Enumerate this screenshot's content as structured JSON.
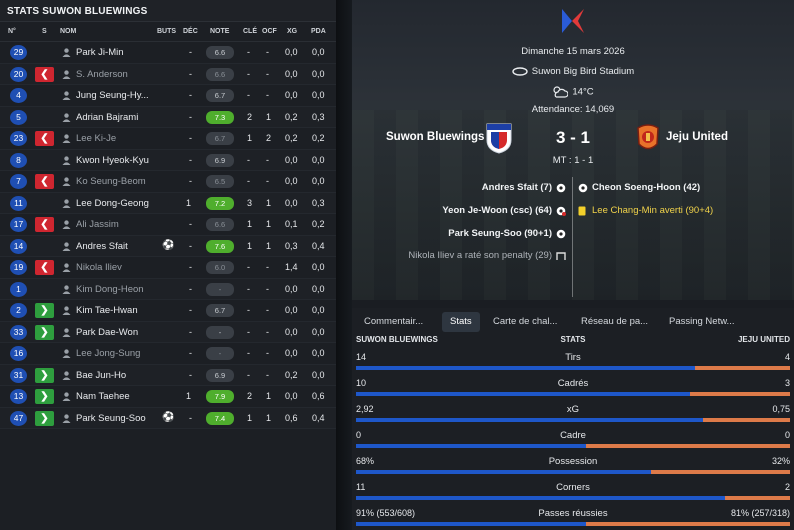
{
  "left": {
    "title": "STATS SUWON BLUEWINGS",
    "columns": {
      "no": "N°",
      "s": "S",
      "nom": "NOM",
      "buts": "BUTS",
      "dec": "DÉC",
      "note": "NOTE",
      "cle": "CLÉ",
      "ocf": "OCF",
      "xg": "XG",
      "pda": "PDA"
    },
    "players": [
      {
        "num": "29",
        "sub": "",
        "name": "Park Ji-Min",
        "goal": false,
        "buts": "",
        "dec": "-",
        "note": "6.6",
        "hi": false,
        "cle": "-",
        "ocf": "-",
        "xg": "0,0",
        "pda": "0,0",
        "dim": false
      },
      {
        "num": "20",
        "sub": "out",
        "name": "S. Anderson",
        "goal": false,
        "buts": "",
        "dec": "-",
        "note": "6.6",
        "hi": false,
        "cle": "-",
        "ocf": "-",
        "xg": "0,0",
        "pda": "0,0",
        "dim": true
      },
      {
        "num": "4",
        "sub": "",
        "name": "Jung Seung-Hy...",
        "goal": false,
        "buts": "",
        "dec": "-",
        "note": "6.7",
        "hi": false,
        "cle": "-",
        "ocf": "-",
        "xg": "0,0",
        "pda": "0,0",
        "dim": false
      },
      {
        "num": "5",
        "sub": "",
        "name": "Adrian Bajrami",
        "goal": false,
        "buts": "",
        "dec": "-",
        "note": "7.3",
        "hi": true,
        "cle": "2",
        "ocf": "1",
        "xg": "0,2",
        "pda": "0,3",
        "dim": false
      },
      {
        "num": "23",
        "sub": "out",
        "name": "Lee Ki-Je",
        "goal": false,
        "buts": "",
        "dec": "-",
        "note": "6.7",
        "hi": false,
        "cle": "1",
        "ocf": "2",
        "xg": "0,2",
        "pda": "0,2",
        "dim": true
      },
      {
        "num": "8",
        "sub": "",
        "name": "Kwon Hyeok-Kyu",
        "goal": false,
        "buts": "",
        "dec": "-",
        "note": "6.9",
        "hi": false,
        "cle": "-",
        "ocf": "-",
        "xg": "0,0",
        "pda": "0,0",
        "dim": false
      },
      {
        "num": "7",
        "sub": "out",
        "name": "Ko Seung-Beom",
        "goal": false,
        "buts": "",
        "dec": "-",
        "note": "6.5",
        "hi": false,
        "cle": "-",
        "ocf": "-",
        "xg": "0,0",
        "pda": "0,0",
        "dim": true
      },
      {
        "num": "11",
        "sub": "",
        "name": "Lee Dong-Geong",
        "goal": false,
        "buts": "1",
        "dec": "",
        "note": "7.2",
        "hi": true,
        "cle": "3",
        "ocf": "1",
        "xg": "0,0",
        "pda": "0,3",
        "dim": false
      },
      {
        "num": "17",
        "sub": "out",
        "name": "Ali Jassim",
        "goal": false,
        "buts": "",
        "dec": "-",
        "note": "6.6",
        "hi": false,
        "cle": "1",
        "ocf": "1",
        "xg": "0,1",
        "pda": "0,2",
        "dim": true
      },
      {
        "num": "14",
        "sub": "",
        "name": "Andres Sfait",
        "goal": true,
        "buts": "",
        "dec": "-",
        "note": "7.6",
        "hi": true,
        "cle": "1",
        "ocf": "1",
        "xg": "0,3",
        "pda": "0,4",
        "dim": false
      },
      {
        "num": "19",
        "sub": "out",
        "name": "Nikola Iliev",
        "goal": false,
        "buts": "",
        "dec": "-",
        "note": "6.0",
        "hi": false,
        "cle": "-",
        "ocf": "-",
        "xg": "1,4",
        "pda": "0,0",
        "dim": true
      },
      {
        "num": "1",
        "sub": "",
        "name": "Kim Dong-Heon",
        "goal": false,
        "buts": "",
        "dec": "-",
        "note": "-",
        "hi": false,
        "cle": "-",
        "ocf": "-",
        "xg": "0,0",
        "pda": "0,0",
        "dim": true
      },
      {
        "num": "2",
        "sub": "in",
        "name": "Kim Tae-Hwan",
        "goal": false,
        "buts": "",
        "dec": "-",
        "note": "6.7",
        "hi": false,
        "cle": "-",
        "ocf": "-",
        "xg": "0,0",
        "pda": "0,0",
        "dim": false
      },
      {
        "num": "33",
        "sub": "in",
        "name": "Park Dae-Won",
        "goal": false,
        "buts": "",
        "dec": "-",
        "note": "-",
        "hi": false,
        "cle": "-",
        "ocf": "-",
        "xg": "0,0",
        "pda": "0,0",
        "dim": false
      },
      {
        "num": "16",
        "sub": "",
        "name": "Lee Jong-Sung",
        "goal": false,
        "buts": "",
        "dec": "-",
        "note": "-",
        "hi": false,
        "cle": "-",
        "ocf": "-",
        "xg": "0,0",
        "pda": "0,0",
        "dim": true
      },
      {
        "num": "31",
        "sub": "in",
        "name": "Bae Jun-Ho",
        "goal": false,
        "buts": "",
        "dec": "-",
        "note": "6.9",
        "hi": false,
        "cle": "-",
        "ocf": "-",
        "xg": "0,2",
        "pda": "0,0",
        "dim": false
      },
      {
        "num": "13",
        "sub": "in",
        "name": "Nam Taehee",
        "goal": false,
        "buts": "1",
        "dec": "",
        "note": "7.9",
        "hi": true,
        "cle": "2",
        "ocf": "1",
        "xg": "0,0",
        "pda": "0,6",
        "dim": false
      },
      {
        "num": "47",
        "sub": "in",
        "name": "Park Seung-Soo",
        "goal": true,
        "buts": "",
        "dec": "-",
        "note": "7.4",
        "hi": true,
        "cle": "1",
        "ocf": "1",
        "xg": "0,6",
        "pda": "0,4",
        "dim": false
      }
    ]
  },
  "match": {
    "date": "Dimanche 15 mars 2026",
    "stadium": "Suwon Big Bird Stadium",
    "weather": "14°C",
    "attendance": "Attendance: 14,069",
    "home": "Suwon Bluewings",
    "away": "Jeju United",
    "score": "3 - 1",
    "halftime": "MT : 1 - 1",
    "events_left": [
      {
        "text": "Andres Sfait (7)",
        "icon": "ball"
      },
      {
        "text": "Yeon Je-Woon (csc) (64)",
        "icon": "ball-red"
      },
      {
        "text": "Park Seung-Soo (90+1)",
        "icon": "ball"
      },
      {
        "text": "Nikola Iliev a raté son penalty (29)",
        "icon": "goal-post"
      }
    ],
    "events_right": [
      {
        "text": "Cheon Soeng-Hoon (42)",
        "icon": "ball"
      },
      {
        "text": "Lee Chang-Min averti (90+4)",
        "icon": "yellow-card"
      }
    ]
  },
  "tabs": [
    "Commentair...",
    "Stats",
    "Carte de chal...",
    "Réseau de pa...",
    "Passing Netw..."
  ],
  "stats": {
    "home_label": "SUWON BLUEWINGS",
    "mid_label": "STATS",
    "away_label": "JEJU UNITED",
    "rows": [
      {
        "label": "Tirs",
        "home": "14",
        "away": "4",
        "home_share": 0.78
      },
      {
        "label": "Cadrés",
        "home": "10",
        "away": "3",
        "home_share": 0.77
      },
      {
        "label": "xG",
        "home": "2,92",
        "away": "0,75",
        "home_share": 0.8
      },
      {
        "label": "Cadre",
        "home": "0",
        "away": "0",
        "home_share": 0.53
      },
      {
        "label": "Possession",
        "home": "68%",
        "away": "32%",
        "home_share": 0.68
      },
      {
        "label": "Corners",
        "home": "11",
        "away": "2",
        "home_share": 0.85
      },
      {
        "label": "Passes réussies",
        "home": "91% (553/608)",
        "away": "81% (257/318)",
        "home_share": 0.53
      }
    ]
  },
  "colors": {
    "home_bar": "#1e57c9",
    "away_bar": "#dd7a49",
    "rating_high": "#4fae2d",
    "sub_out": "#cf2630",
    "sub_in": "#2e9e3e"
  }
}
